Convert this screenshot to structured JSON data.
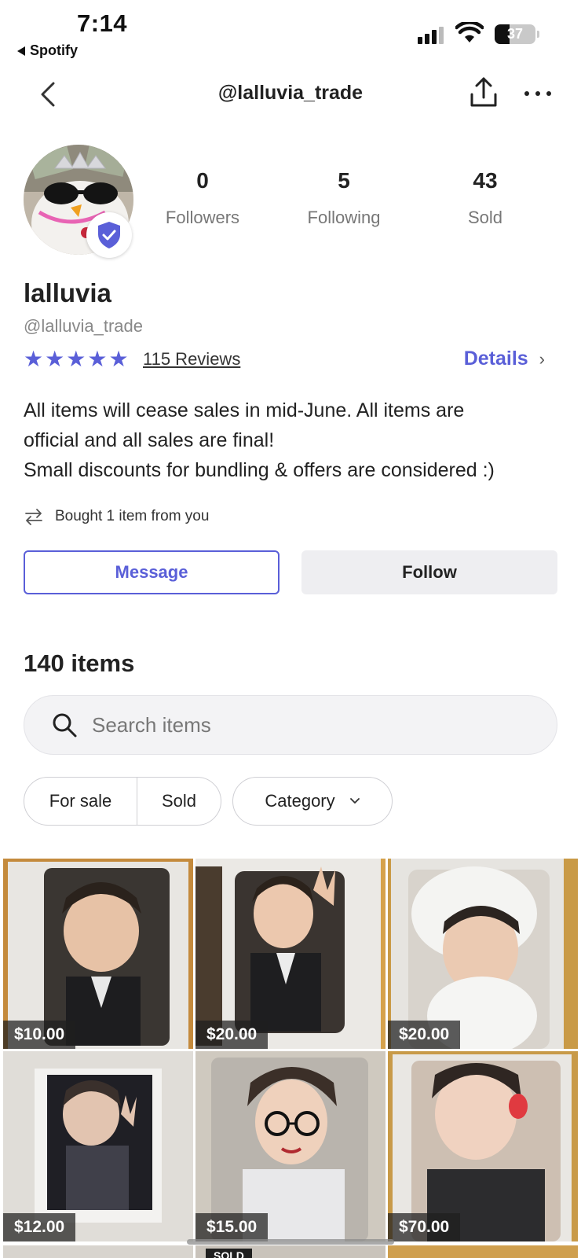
{
  "status_bar": {
    "time": "7:14",
    "back_app": "Spotify",
    "battery": "37",
    "battery_level": 0.37
  },
  "nav": {
    "title": "@lalluvia_trade"
  },
  "profile": {
    "stats": [
      {
        "value": "0",
        "label": "Followers"
      },
      {
        "value": "5",
        "label": "Following"
      },
      {
        "value": "43",
        "label": "Sold"
      }
    ],
    "display_name": "lalluvia",
    "handle": "@lalluvia_trade",
    "rating": 5,
    "reviews": "115 Reviews",
    "details_label": "Details",
    "bio": [
      "All items will cease sales in mid-June. All items are",
      "official and all sales are final!",
      "Small discounts for bundling & offers are considered :)"
    ],
    "bought_note": "Bought 1 item from you"
  },
  "actions": {
    "message": "Message",
    "follow": "Follow"
  },
  "listing": {
    "items_count": "140 items",
    "search_placeholder": "Search items",
    "filters": {
      "for_sale": "For sale",
      "sold": "Sold",
      "category": "Category"
    },
    "items": [
      {
        "price": "$10.00"
      },
      {
        "price": "$20.00"
      },
      {
        "price": "$20.00"
      },
      {
        "price": "$12.00"
      },
      {
        "price": "$15.00"
      },
      {
        "price": "$70.00"
      }
    ],
    "partial_sold_label": "SOLD"
  },
  "colors": {
    "accent": "#5a5fd8",
    "muted_text": "#777777",
    "button_bg": "#eeeef1"
  }
}
